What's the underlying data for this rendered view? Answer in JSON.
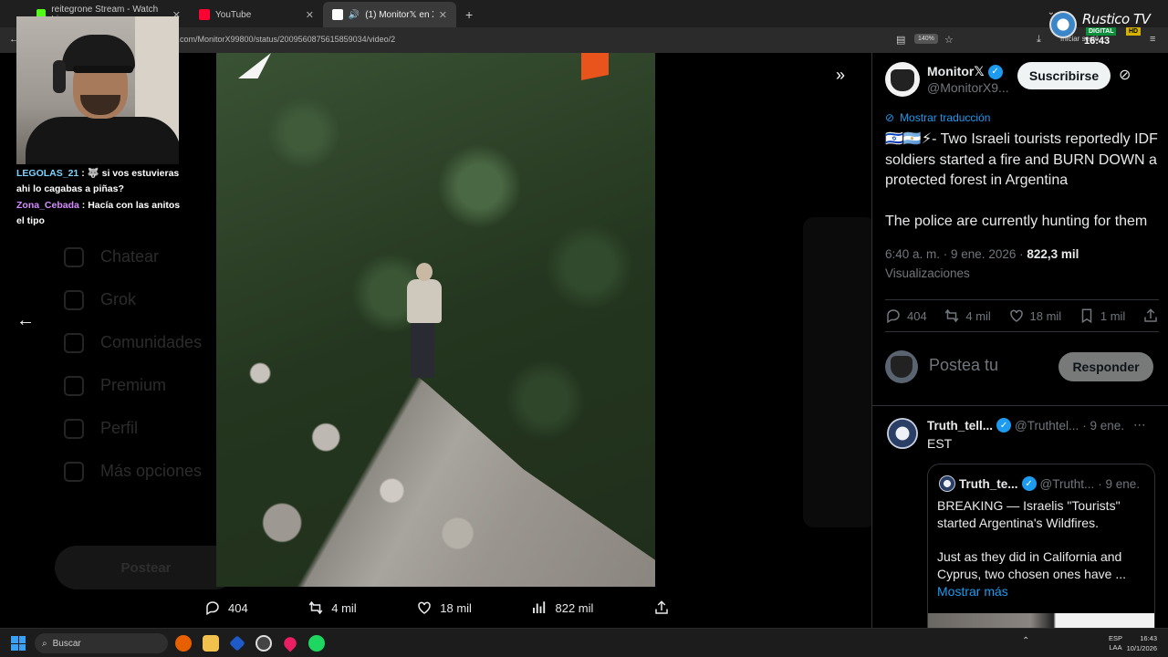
{
  "browser": {
    "tabs": [
      {
        "label": "reitegrone Stream - Watch Live",
        "color": "#53fc18"
      },
      {
        "label": "YouTube",
        "color": "#ff0033"
      },
      {
        "label": "(1) Monitor𝕏 en X: \"🇮🇱🇦🇷",
        "color": "#ffffff",
        "active": true
      }
    ],
    "url": "x.com/MonitorX99800/status/2009560875615859034/video/2",
    "zoom": "140%",
    "signin": "Iniciar sesió"
  },
  "stream": {
    "channel": "Rustico TV",
    "tag": "DIGITAL",
    "hd": "HD",
    "time": "16:43",
    "chat": [
      {
        "user": "LEGOLAS_21",
        "text": ": 🐺 si vos estuvieras ahi lo cagabas a piñas?"
      },
      {
        "user": "Zona_Cebada",
        "text": ": Hacía con las anitos el tipo"
      }
    ]
  },
  "dim_nav": [
    "Chatear",
    "Grok",
    "Comunidades",
    "Premium",
    "Perfil",
    "Más opciones"
  ],
  "dim_post": "Postear",
  "video": {
    "actions": {
      "replies": "404",
      "reposts": "4 mil",
      "likes": "18 mil",
      "views": "822 mil"
    }
  },
  "panel": {
    "author": {
      "name": "Monitor𝕏",
      "handle": "@MonitorX9..."
    },
    "subscribe": "Suscribirse",
    "translate": "Mostrar traducción",
    "tweet": {
      "line1": "🇮🇱🇦🇷⚡- Two Israeli tourists reportedly IDF soldiers started a fire and BURN DOWN a protected forest in Argentina",
      "line2": "The police are currently hunting for them"
    },
    "meta": {
      "time": "6:40 a. m. · 9 ene. 2026 · ",
      "views_count": "822,3 mil",
      "views_label": "Visualizaciones"
    },
    "actions": {
      "replies": "404",
      "reposts": "4 mil",
      "likes": "18 mil",
      "bookmarks": "1 mil"
    },
    "reply_placeholder": "Postea tu",
    "reply_button": "Responder",
    "reply": {
      "name": "Truth_tell...",
      "handle": "@Truthtel...",
      "date": "· 9 ene.",
      "text": "EST",
      "quote": {
        "name": "Truth_te...",
        "handle": "@Trutht...",
        "date": "· 9 ene.",
        "p1": "BREAKING — Israelis \"Tourists\" started Argentina's Wildfires.",
        "p2": "Just as they did in California and Cyprus, two chosen ones have ...",
        "more": "Mostrar más"
      }
    }
  },
  "taskbar": {
    "search": "Buscar",
    "lang1": "ESP",
    "lang2": "LAA",
    "time": "16:43",
    "date": "10/1/2026"
  }
}
